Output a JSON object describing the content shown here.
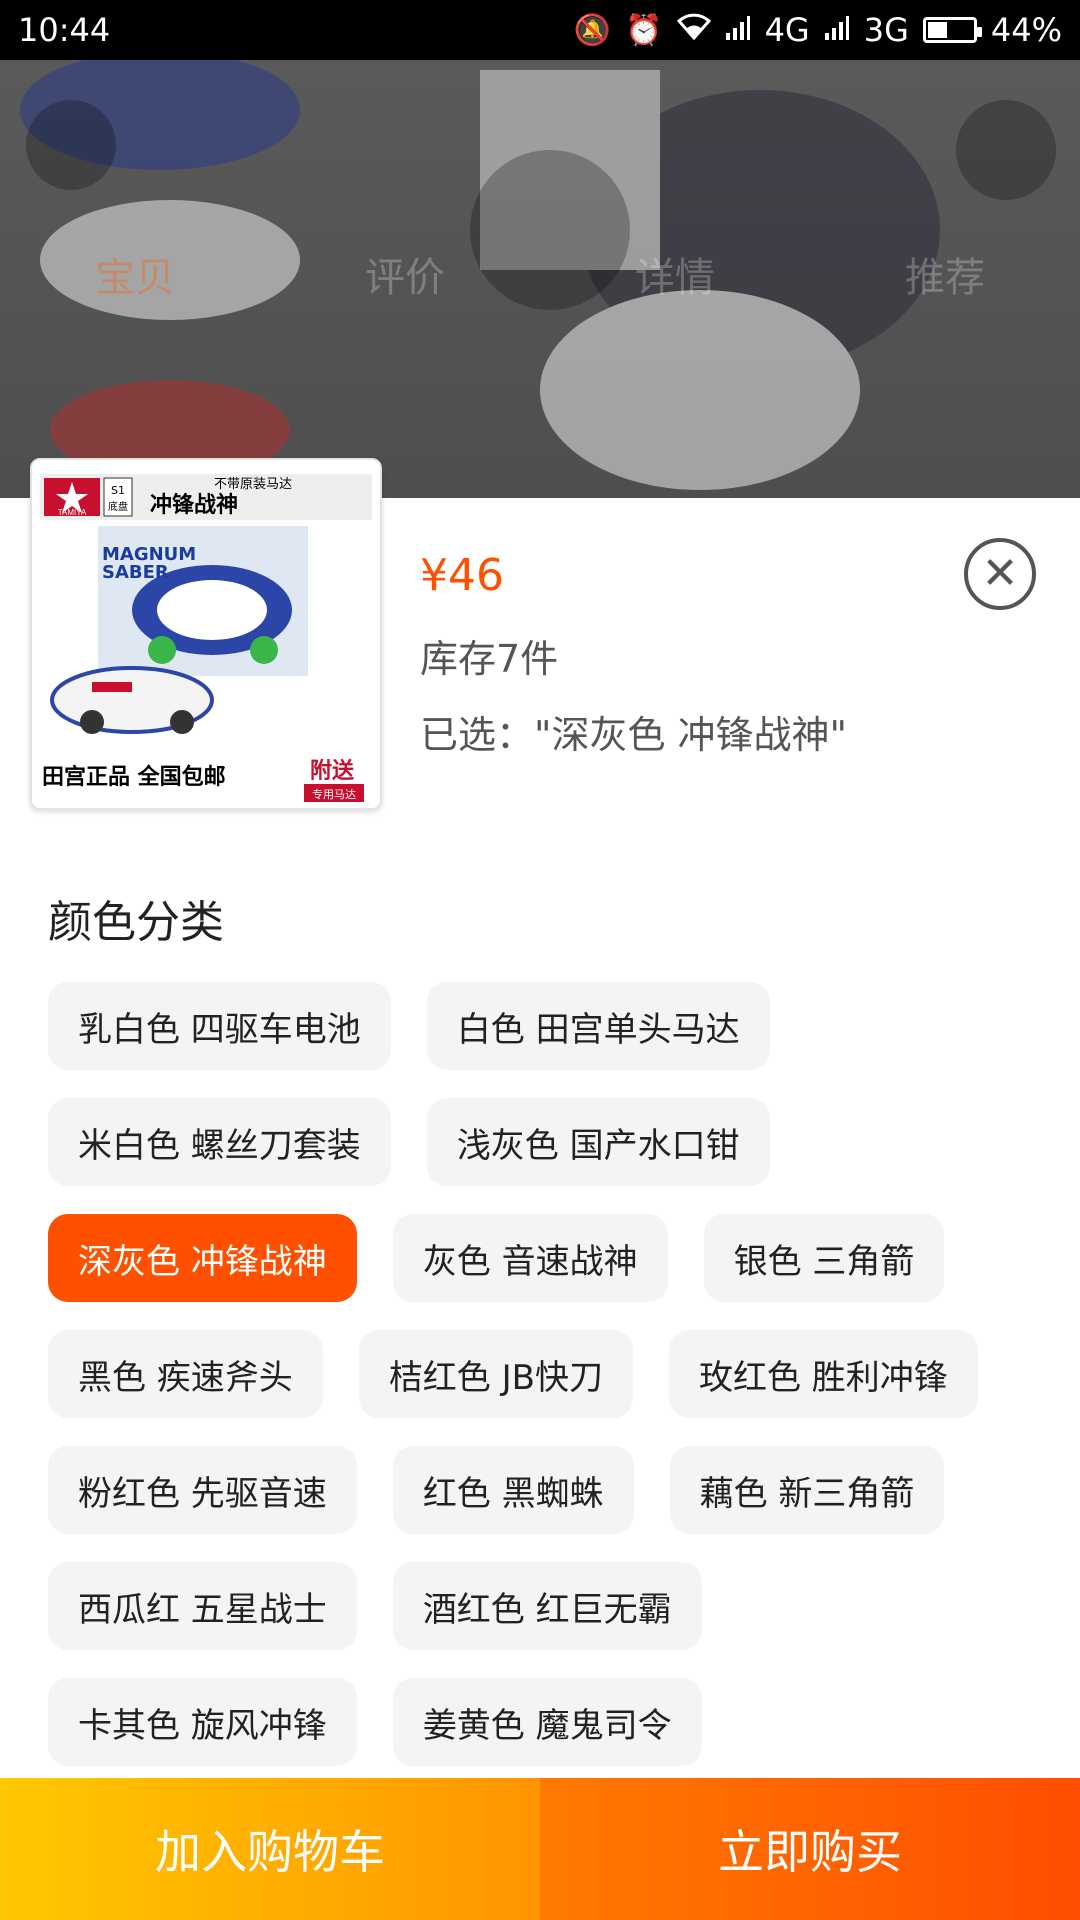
{
  "status_bar": {
    "time": "10:44",
    "network1": "4G",
    "network2": "3G",
    "battery_text": "44%",
    "battery_level": 0.44
  },
  "background_tabs": [
    "宝贝",
    "评价",
    "详情",
    "推荐"
  ],
  "product": {
    "price": "¥46",
    "stock": "库存7件",
    "selected": "已选：\"深灰色 冲锋战神\"",
    "thumb": {
      "brand": "TAMIYA",
      "chassis": "S1\n底盘",
      "tagline": "不带原装马达",
      "name_cn": "冲锋战神",
      "name_en": "MAGNUM SABER",
      "bottom_left": "田宫正品 全国包邮",
      "bottom_right_top": "附送",
      "bottom_right_bottom": "专用马达"
    }
  },
  "sku": {
    "title": "颜色分类",
    "rows": [
      [
        "乳白色 四驱车电池",
        "白色 田宫单头马达"
      ],
      [
        "米白色 螺丝刀套装",
        "浅灰色 国产水口钳"
      ],
      [
        "深灰色 冲锋战神",
        "灰色 音速战神",
        "银色 三角箭"
      ],
      [
        "黑色 疾速斧头",
        "桔红色 JB快刀",
        "玫红色 胜利冲锋"
      ],
      [
        "粉红色 先驱音速",
        "红色 黑蜘蛛",
        "藕色 新三角箭"
      ],
      [
        "西瓜红 五星战士",
        "酒红色 红巨无霸"
      ],
      [
        "卡其色 旋风冲锋",
        "姜黄色 魔鬼司令"
      ]
    ],
    "selected_value": "深灰色 冲锋战神"
  },
  "buttons": {
    "add_to_cart": "加入购物车",
    "buy_now": "立即购买"
  },
  "colors": {
    "accent": "#ff5000",
    "cart_start": "#ffc800",
    "cart_end": "#ff9500",
    "buy_start": "#ff7a00",
    "buy_end": "#ff4e00"
  }
}
